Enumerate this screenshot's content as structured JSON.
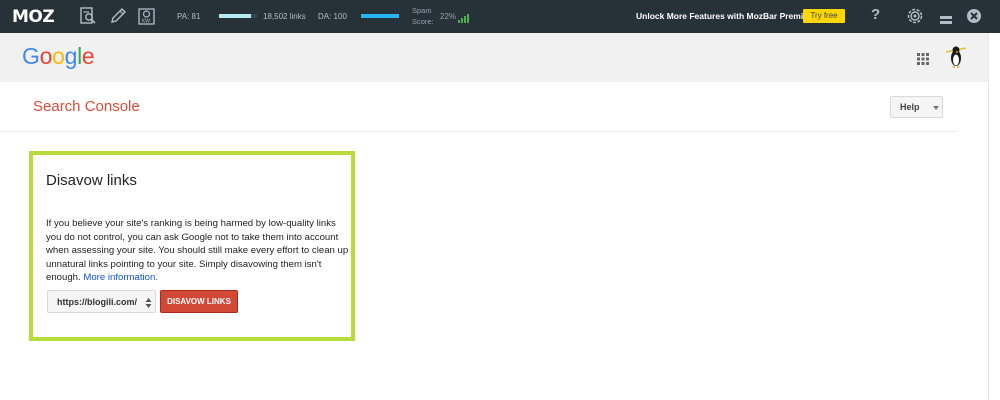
{
  "mozbar": {
    "logo": "MOZ",
    "pa_label": "PA: 81",
    "pa_fill": 0.85,
    "links_count": "18,502 links",
    "da_label": "DA: 100",
    "da_fill": 1.0,
    "spam_label_line1": "Spam",
    "spam_label_line2": "Score:",
    "spam_value": "22%",
    "premium_text": "Unlock More Features with MozBar Premium",
    "try_free": "Try free",
    "help": "?",
    "colors": {
      "background": "#263238",
      "da_bar": "#29b6f6",
      "try_free": "#ffd600"
    },
    "icons": [
      "page-analysis-icon",
      "highlighter-icon",
      "keyword-icon",
      "gear-icon",
      "minimize-icon",
      "close-icon"
    ]
  },
  "google": {
    "logo_letters": [
      {
        "char": "G",
        "color": "#4285f4"
      },
      {
        "char": "o",
        "color": "#ea4335"
      },
      {
        "char": "o",
        "color": "#fbbc05"
      },
      {
        "char": "g",
        "color": "#4285f4"
      },
      {
        "char": "l",
        "color": "#34a853"
      },
      {
        "char": "e",
        "color": "#ea4335"
      }
    ],
    "icons": [
      "apps-grid-icon",
      "avatar-penguin-icon"
    ]
  },
  "search_console": {
    "title": "Search Console",
    "help_button": "Help"
  },
  "disavow": {
    "title": "Disavow links",
    "description": "If you believe your site's ranking is being harmed by low-quality links you do not control, you can ask Google not to take them into account when assessing your site. You should still make every effort to clean up unnatural links pointing to your site. Simply disavowing them isn't enough.",
    "more_info": "More information.",
    "site_selected": "https://blogili.com/",
    "button": "DISAVOW LINKS",
    "colors": {
      "highlight_border": "#b8dc3a",
      "button": "#d14836",
      "title": "#dd4b39",
      "link": "#1155cc"
    }
  }
}
